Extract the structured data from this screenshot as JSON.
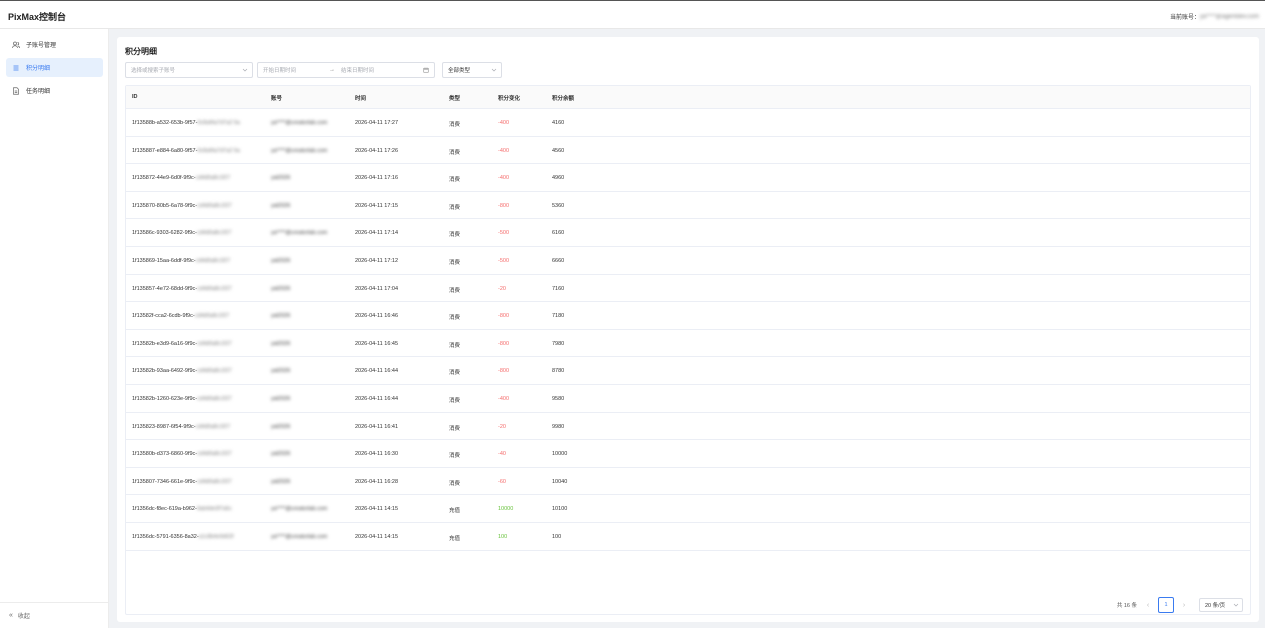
{
  "app": {
    "brand": "PixMax控制台",
    "account_label": "当前账号：",
    "account_value": "ya****@agentdev.com"
  },
  "sidebar": {
    "items": [
      {
        "label": "子账号管理",
        "icon": "users-icon",
        "active": false
      },
      {
        "label": "积分明细",
        "icon": "list-icon",
        "active": true
      },
      {
        "label": "任务明细",
        "icon": "document-icon",
        "active": false
      }
    ],
    "collapse_label": "收起"
  },
  "page": {
    "title": "积分明细",
    "filters": {
      "account_placeholder": "选择或搜索子账号",
      "start_placeholder": "开始日期时间",
      "end_placeholder": "结束日期时间",
      "type_value": "全部类型"
    }
  },
  "table": {
    "headers": [
      "ID",
      "账号",
      "时间",
      "类型",
      "积分变化",
      "积分余额"
    ],
    "rows": [
      {
        "id": "1f13588b-a532-653b-9f57-",
        "id_tail": "0c8af4a7d7a2 5a",
        "account": "ya****@creatorlab.com",
        "time": "2026-04-11 17:27",
        "type": "消费",
        "change": "-400",
        "balance": "4160"
      },
      {
        "id": "1f135887-e884-6a80-9f57-",
        "id_tail": "0c8af4a7d7a2 5a",
        "account": "ya****@creatorlab.com",
        "time": "2026-04-11 17:26",
        "type": "消费",
        "change": "-400",
        "balance": "4560"
      },
      {
        "id": "1f135872-44e9-6d0f-9f9c-",
        "id_tail": "cd4d0a8c1f27",
        "account": "yal2026",
        "time": "2026-04-11 17:16",
        "type": "消费",
        "change": "-400",
        "balance": "4960"
      },
      {
        "id": "1f135870-80b5-6a78-9f9c-",
        "id_tail": "cd4d0a8c1f27",
        "account": "yal2026",
        "time": "2026-04-11 17:15",
        "type": "消费",
        "change": "-800",
        "balance": "5360"
      },
      {
        "id": "1f13586c-9303-6282-9f9c-",
        "id_tail": "cd4d0a8c1f27",
        "account": "ya****@creatorlab.com",
        "time": "2026-04-11 17:14",
        "type": "消费",
        "change": "-500",
        "balance": "6160"
      },
      {
        "id": "1f135869-15aa-6ddf-9f9c-",
        "id_tail": "cd4d0a8c1f27",
        "account": "yal2026",
        "time": "2026-04-11 17:12",
        "type": "消费",
        "change": "-500",
        "balance": "6660"
      },
      {
        "id": "1f135857-4e72-68dd-9f9c-",
        "id_tail": "cd4d0a8c1f27",
        "account": "yal2026",
        "time": "2026-04-11 17:04",
        "type": "消费",
        "change": "-20",
        "balance": "7160"
      },
      {
        "id": "1f13582f-cca2-6cdb-9f9c-",
        "id_tail": "cd4d0a8c1f27",
        "account": "yal2026",
        "time": "2026-04-11 16:46",
        "type": "消费",
        "change": "-800",
        "balance": "7180"
      },
      {
        "id": "1f13582b-e3d9-6a16-9f9c-",
        "id_tail": "cd4d0a8c1f27",
        "account": "yal2026",
        "time": "2026-04-11 16:45",
        "type": "消费",
        "change": "-800",
        "balance": "7980"
      },
      {
        "id": "1f13582b-93aa-6492-9f9c-",
        "id_tail": "cd4d0a8c1f27",
        "account": "yal2026",
        "time": "2026-04-11 16:44",
        "type": "消费",
        "change": "-800",
        "balance": "8780"
      },
      {
        "id": "1f13582b-1260-623e-9f9c-",
        "id_tail": "cd4d0a8c1f27",
        "account": "yal2026",
        "time": "2026-04-11 16:44",
        "type": "消费",
        "change": "-400",
        "balance": "9580"
      },
      {
        "id": "1f135823-8987-6f54-9f9c-",
        "id_tail": "cd4d0a8c1f27",
        "account": "yal2026",
        "time": "2026-04-11 16:41",
        "type": "消费",
        "change": "-20",
        "balance": "9980"
      },
      {
        "id": "1f13580b-d373-6860-9f9c-",
        "id_tail": "cd4d0a8c1f27",
        "account": "yal2026",
        "time": "2026-04-11 16:30",
        "type": "消费",
        "change": "-40",
        "balance": "10000"
      },
      {
        "id": "1f135807-7346-661e-9f9c-",
        "id_tail": "cd4d0a8c1f27",
        "account": "yal2026",
        "time": "2026-04-11 16:28",
        "type": "消费",
        "change": "-60",
        "balance": "10040"
      },
      {
        "id": "1f1356dc-f8ec-619a-b962-",
        "id_tail": "9ab4de3f7a5c",
        "account": "ya****@creatorlab.com",
        "time": "2026-04-11 14:15",
        "type": "充值",
        "change": "10000",
        "balance": "10100"
      },
      {
        "id": "1f1356dc-5791-6356-8a32-",
        "id_tail": "a1c8b4e9d02f",
        "account": "ya****@creatorlab.com",
        "time": "2026-04-11 14:15",
        "type": "充值",
        "change": "100",
        "balance": "100"
      }
    ]
  },
  "pagination": {
    "total_label": "共 16 条",
    "current_page": "1",
    "page_size": "20 条/页"
  },
  "colors": {
    "accent": "#3a7bf0",
    "negative": "#f56c6c",
    "positive": "#67c23a"
  }
}
